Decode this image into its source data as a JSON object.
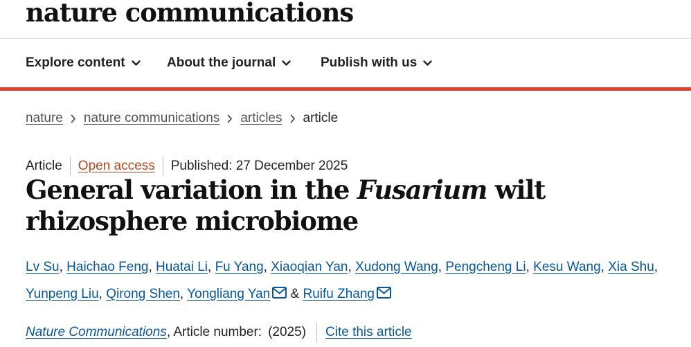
{
  "site": {
    "logo_text": "nature communications"
  },
  "nav": {
    "items": [
      {
        "label": "Explore content",
        "icon": "chevron-down-icon"
      },
      {
        "label": "About the journal",
        "icon": "chevron-down-icon"
      },
      {
        "label": "Publish with us",
        "icon": "chevron-down-icon"
      }
    ],
    "accent_color": "#e0402d"
  },
  "breadcrumb": {
    "items": [
      "nature",
      "nature communications",
      "articles"
    ],
    "current": "article",
    "separator_icon": "chevron-right-icon"
  },
  "article": {
    "type": "Article",
    "access": "Open access",
    "published": "Published: 27 December 2025",
    "title_part1": "General variation in the ",
    "title_italic": "Fusarium",
    "title_part2": " wilt rhizosphere microbiome",
    "authors": [
      "Lv Su",
      "Haichao Feng",
      "Huatai Li",
      "Fu Yang",
      "Xiaoqian Yan",
      "Xudong Wang",
      "Pengcheng Li",
      "Kesu Wang",
      "Xia Shu",
      "Yunpeng Liu",
      "Qirong Shen",
      "Yongliang Yan",
      "Ruifu Zhang"
    ],
    "author_separator": ", ",
    "author_conjunction": " & ",
    "corresponding_icon": "mail-icon",
    "journal": "Nature Communications",
    "article_number_label": ", Article number:",
    "year": "(2025)",
    "cite_label": "Cite this article",
    "link_color": "#06579e",
    "access_color": "#b5471f"
  }
}
